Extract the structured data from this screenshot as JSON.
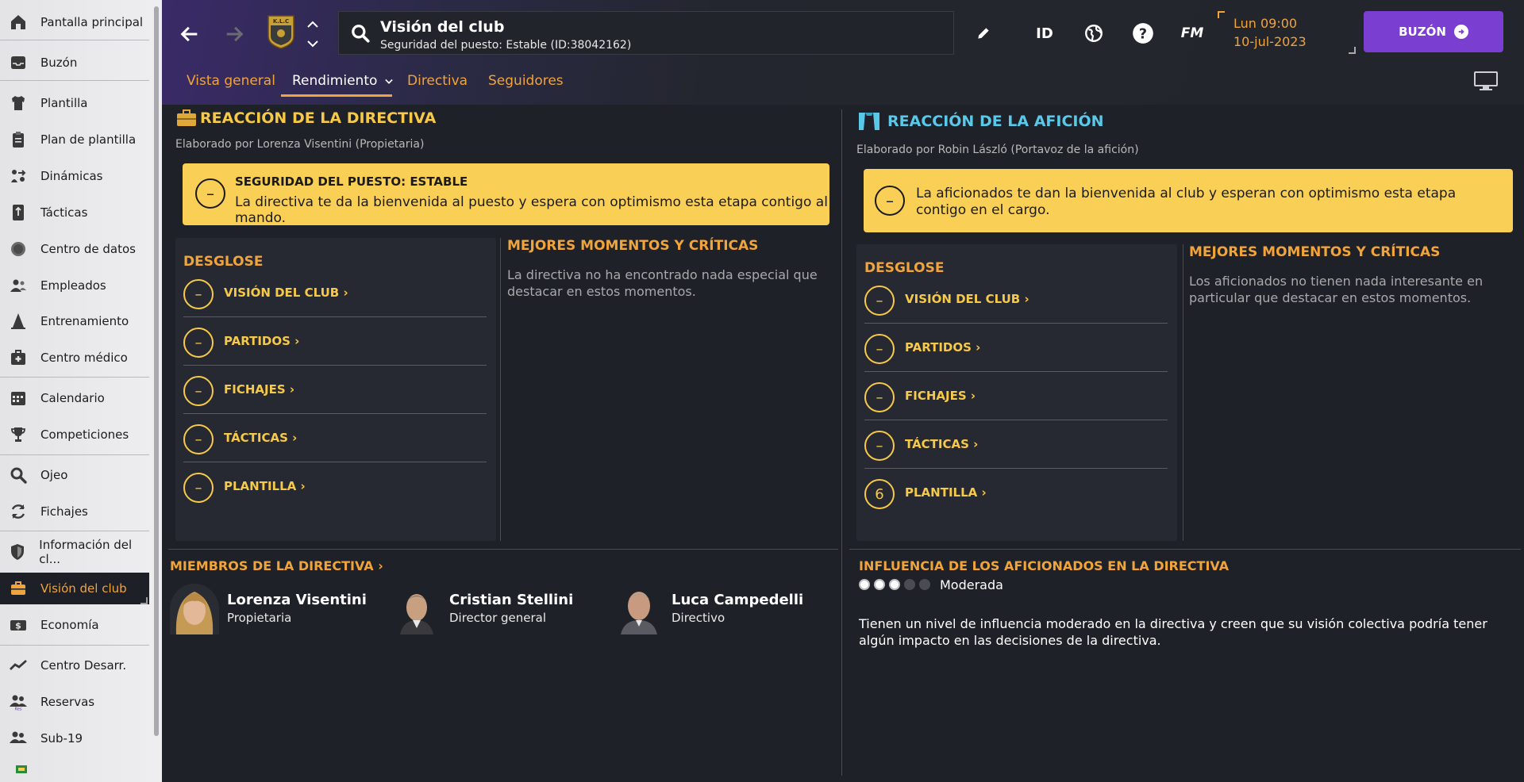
{
  "sidebar": {
    "items": [
      {
        "label": "Pantalla principal",
        "icon": "home-icon"
      },
      {
        "label": "Buzón",
        "icon": "inbox-icon"
      },
      {
        "label": "Plantilla",
        "icon": "shirt-icon"
      },
      {
        "label": "Plan de plantilla",
        "icon": "clipboard-icon"
      },
      {
        "label": "Dinámicas",
        "icon": "dynamics-icon"
      },
      {
        "label": "Tácticas",
        "icon": "tactics-board-icon"
      },
      {
        "label": "Centro de datos",
        "icon": "data-hub-icon"
      },
      {
        "label": "Empleados",
        "icon": "staff-icon"
      },
      {
        "label": "Entrenamiento",
        "icon": "training-cone-icon"
      },
      {
        "label": "Centro médico",
        "icon": "medical-kit-icon"
      },
      {
        "label": "Calendario",
        "icon": "calendar-icon"
      },
      {
        "label": "Competiciones",
        "icon": "trophy-icon"
      },
      {
        "label": "Ojeo",
        "icon": "magnifier-icon"
      },
      {
        "label": "Fichajes",
        "icon": "transfer-icon"
      },
      {
        "label": "Información del cl...",
        "icon": "club-shield-icon"
      },
      {
        "label": "Visión del club",
        "icon": "briefcase-icon"
      },
      {
        "label": "Economía",
        "icon": "finance-icon"
      },
      {
        "label": "Centro Desarr.",
        "icon": "development-chart-icon"
      },
      {
        "label": "Reservas",
        "icon": "reserves-icon"
      },
      {
        "label": "Sub-19",
        "icon": "u19-icon"
      }
    ]
  },
  "topbar": {
    "search_title": "Visión del club",
    "search_subtitle": "Seguridad del puesto: Estable (ID:38042162)",
    "crest_text": "K.L.C",
    "id_label": "ID",
    "fm_label": "FM",
    "date_line1": "Lun 09:00",
    "date_line2": "10-jul-2023",
    "inbox_button": "BUZÓN"
  },
  "tabs": [
    {
      "label": "Vista general"
    },
    {
      "label": "Rendimiento"
    },
    {
      "label": "Directiva"
    },
    {
      "label": "Seguidores"
    }
  ],
  "board": {
    "title": "REACCIÓN DE LA DIRECTIVA",
    "author": "Elaborado por Lorenza Visentini (Propietaria)",
    "alert_title": "SEGURIDAD DEL PUESTO: ESTABLE",
    "alert_text": "La directiva te da la bienvenida al puesto y espera con optimismo esta etapa contigo al mando.",
    "alert_symbol": "–",
    "breakdown_title": "DESGLOSE",
    "breakdown": [
      {
        "label": "VISIÓN DEL CLUB",
        "value": "–"
      },
      {
        "label": "PARTIDOS",
        "value": "–"
      },
      {
        "label": "FICHAJES",
        "value": "–"
      },
      {
        "label": "TÁCTICAS",
        "value": "–"
      },
      {
        "label": "PLANTILLA",
        "value": "–"
      }
    ],
    "highlights_title": "MEJORES MOMENTOS Y CRÍTICAS",
    "highlights_text": "La directiva no ha encontrado nada especial que destacar en estos momentos.",
    "members_title": "MIEMBROS DE LA DIRECTIVA",
    "members": [
      {
        "name": "Lorenza Visentini",
        "role": "Propietaria"
      },
      {
        "name": "Cristian Stellini",
        "role": "Director general"
      },
      {
        "name": "Luca Campedelli",
        "role": "Directivo"
      }
    ]
  },
  "fans": {
    "title": "REACCIÓN DE LA AFICIÓN",
    "author": "Elaborado por Robin László (Portavoz de la afición)",
    "alert_text": "La aficionados te dan la bienvenida al club y esperan con optimismo esta etapa contigo en el cargo.",
    "alert_symbol": "–",
    "breakdown_title": "DESGLOSE",
    "breakdown": [
      {
        "label": "VISIÓN DEL CLUB",
        "value": "–"
      },
      {
        "label": "PARTIDOS",
        "value": "–"
      },
      {
        "label": "FICHAJES",
        "value": "–"
      },
      {
        "label": "TÁCTICAS",
        "value": "–"
      },
      {
        "label": "PLANTILLA",
        "value": "6"
      }
    ],
    "highlights_title": "MEJORES MOMENTOS Y CRÍTICAS",
    "highlights_text": "Los aficionados no tienen nada interesante en particular que destacar en estos momentos.",
    "influence_title": "INFLUENCIA DE LOS AFICIONADOS EN LA DIRECTIVA",
    "influence_level": "Moderada",
    "influence_rating": 3,
    "influence_max": 5,
    "influence_text": "Tienen un nivel de influencia moderado en la directiva y creen que su visión colectiva podría tener algún impacto en las decisiones de la directiva."
  },
  "colors": {
    "accent": "#f0a43a",
    "fans_accent": "#5ac8e8",
    "alert_bg": "#f9cf55",
    "inbox_button": "#7a3fd0"
  }
}
